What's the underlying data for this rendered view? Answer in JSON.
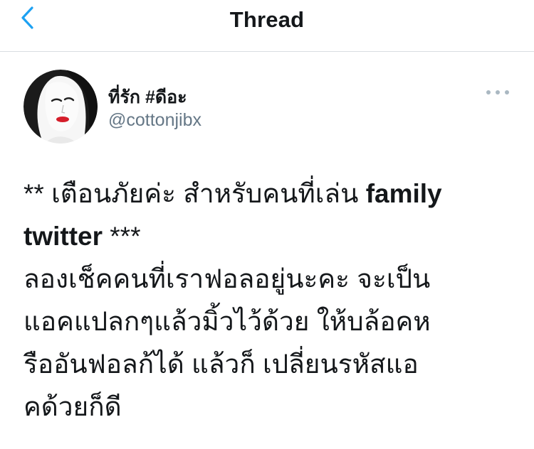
{
  "header": {
    "title": "Thread"
  },
  "tweet": {
    "display_name": "ที่รัก #ดีอะ",
    "handle": "@cottonjibx",
    "text": {
      "line1_prefix": "** เตือนภัยค่ะ สำหรับคนที่เล่น ",
      "line1_bold": "family",
      "line2_bold": "twitter",
      "line2_suffix": " ***",
      "line3": "ลองเช็คคนที่เราฟอลอยู่นะคะ จะเป็น",
      "line4": "แอคแปลกๆแล้วมิ้วไว้ด้วย  ให้บล้อคห",
      "line5": "รืออันฟอลก้ได้ แล้วก็ เปลี่ยนรหัสแอ",
      "line6": "คด้วยก็ดี"
    }
  },
  "icons": {
    "back": "chevron-left-icon",
    "more": "more-horizontal-icon"
  },
  "colors": {
    "accent": "#1da1f2",
    "secondary_text": "#657786",
    "divider": "#d9dde1"
  }
}
